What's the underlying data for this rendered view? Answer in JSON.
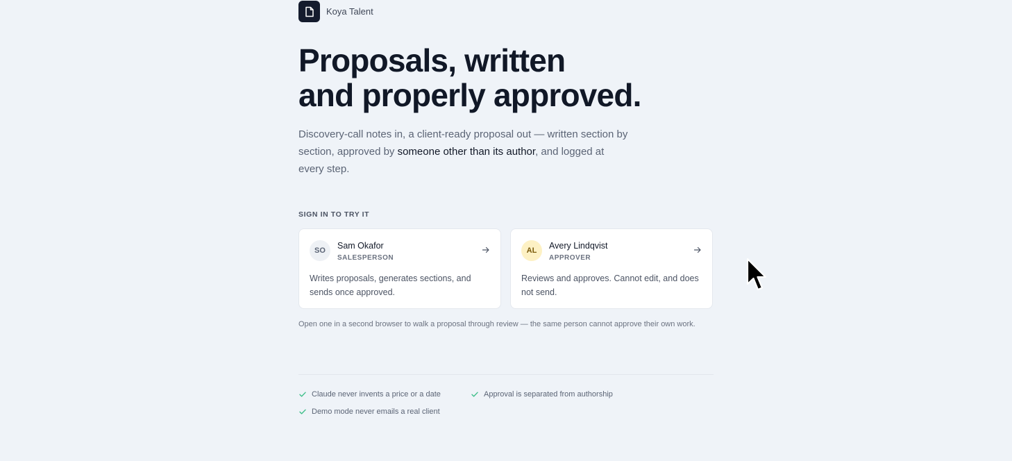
{
  "brand": {
    "name": "Koya Talent",
    "icon": "document-icon"
  },
  "hero": {
    "title_line1": "Proposals, written",
    "title_line2": "and properly approved.",
    "lead_before": "Discovery-call notes in, a client-ready proposal out — written section by section, approved by ",
    "lead_emphasis": "someone other than its author",
    "lead_after": ", and logged at every step."
  },
  "signin": {
    "label": "SIGN IN TO TRY IT",
    "cards": [
      {
        "initials": "SO",
        "name": "Sam Okafor",
        "role": "SALESPERSON",
        "description": "Writes proposals, generates sections, and sends once approved.",
        "icon": "arrow-right-icon"
      },
      {
        "initials": "AL",
        "name": "Avery Lindqvist",
        "role": "APPROVER",
        "description": "Reviews and approves. Cannot edit, and does not send.",
        "icon": "arrow-right-icon"
      }
    ],
    "note": "Open one in a second browser to walk a proposal through review — the same person cannot approve their own work."
  },
  "guarantees": [
    "Claude never invents a price or a date",
    "Approval is separated from authorship",
    "Demo mode never emails a real client"
  ],
  "colors": {
    "background": "#eff3f8",
    "brand_mark": "#141b2d",
    "check": "#3fbf8a",
    "approver_avatar": "#fdf1c4"
  }
}
